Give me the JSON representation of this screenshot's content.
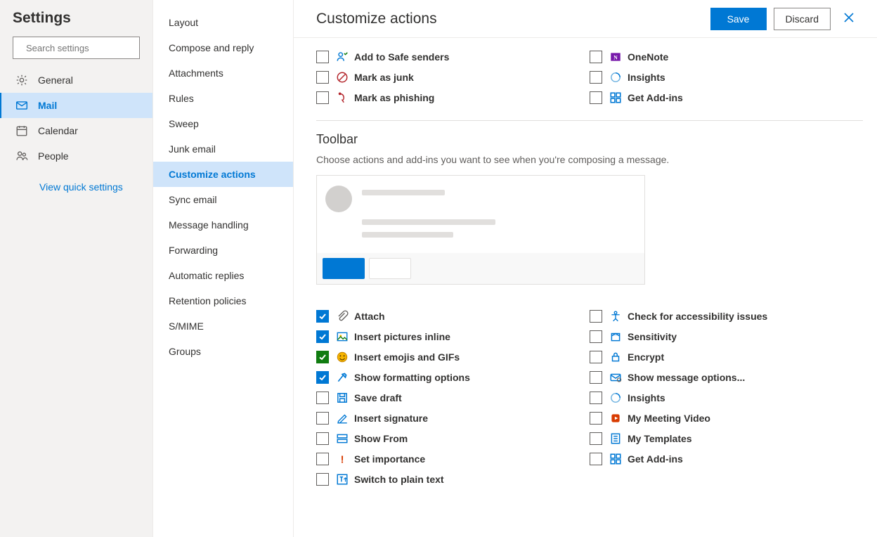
{
  "left": {
    "title": "Settings",
    "search_placeholder": "Search settings",
    "categories": [
      {
        "key": "general",
        "label": "General"
      },
      {
        "key": "mail",
        "label": "Mail"
      },
      {
        "key": "calendar",
        "label": "Calendar"
      },
      {
        "key": "people",
        "label": "People"
      }
    ],
    "active_category": "mail",
    "quick_link": "View quick settings"
  },
  "mid": {
    "items": [
      "Layout",
      "Compose and reply",
      "Attachments",
      "Rules",
      "Sweep",
      "Junk email",
      "Customize actions",
      "Sync email",
      "Message handling",
      "Forwarding",
      "Automatic replies",
      "Retention policies",
      "S/MIME",
      "Groups"
    ],
    "active_index": 6
  },
  "header": {
    "title": "Customize actions",
    "save": "Save",
    "discard": "Discard"
  },
  "surface_top": {
    "left": [
      {
        "label": "Add to Safe senders",
        "icon": "safe-senders-icon"
      },
      {
        "label": "Mark as junk",
        "icon": "junk-icon"
      },
      {
        "label": "Mark as phishing",
        "icon": "phishing-icon"
      }
    ],
    "right": [
      {
        "label": "OneNote",
        "icon": "onenote-icon"
      },
      {
        "label": "Insights",
        "icon": "insights-icon"
      },
      {
        "label": "Get Add-ins",
        "icon": "addins-icon"
      }
    ]
  },
  "toolbar": {
    "heading": "Toolbar",
    "description": "Choose actions and add-ins you want to see when you're composing a message.",
    "left": [
      {
        "label": "Attach",
        "icon": "attach-icon",
        "checked": true
      },
      {
        "label": "Insert pictures inline",
        "icon": "picture-icon",
        "checked": true
      },
      {
        "label": "Insert emojis and GIFs",
        "icon": "emoji-icon",
        "checked": true,
        "green": true,
        "highlight": true
      },
      {
        "label": "Show formatting options",
        "icon": "formatting-icon",
        "checked": true
      },
      {
        "label": "Save draft",
        "icon": "save-draft-icon",
        "checked": false
      },
      {
        "label": "Insert signature",
        "icon": "signature-icon",
        "checked": false
      },
      {
        "label": "Show From",
        "icon": "show-from-icon",
        "checked": false
      },
      {
        "label": "Set importance",
        "icon": "importance-icon",
        "checked": false
      },
      {
        "label": "Switch to plain text",
        "icon": "plaintext-icon",
        "checked": false
      }
    ],
    "right": [
      {
        "label": "Check for accessibility issues",
        "icon": "accessibility-icon",
        "checked": false
      },
      {
        "label": "Sensitivity",
        "icon": "sensitivity-icon",
        "checked": false
      },
      {
        "label": "Encrypt",
        "icon": "encrypt-icon",
        "checked": false
      },
      {
        "label": "Show message options...",
        "icon": "msg-options-icon",
        "checked": false
      },
      {
        "label": "Insights",
        "icon": "insights-icon",
        "checked": false
      },
      {
        "label": "My Meeting Video",
        "icon": "meeting-video-icon",
        "checked": false
      },
      {
        "label": "My Templates",
        "icon": "templates-icon",
        "checked": false
      },
      {
        "label": "Get Add-ins",
        "icon": "addins-icon",
        "checked": false
      }
    ]
  },
  "icons": {
    "gear-icon": "#605e5c",
    "mail-icon": "#0078d4",
    "calendar-icon": "#605e5c",
    "people-icon": "#605e5c"
  }
}
